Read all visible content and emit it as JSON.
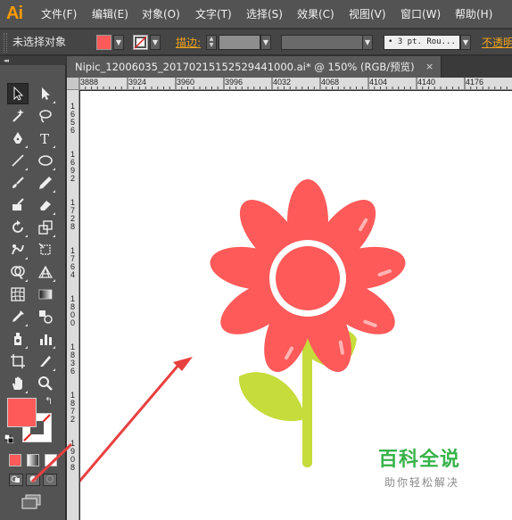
{
  "app": {
    "logo": "Ai"
  },
  "menu": {
    "items": [
      {
        "label": "文件(F)"
      },
      {
        "label": "编辑(E)"
      },
      {
        "label": "对象(O)"
      },
      {
        "label": "文字(T)"
      },
      {
        "label": "选择(S)"
      },
      {
        "label": "效果(C)"
      },
      {
        "label": "视图(V)"
      },
      {
        "label": "窗口(W)"
      },
      {
        "label": "帮助(H)"
      }
    ]
  },
  "controlbar": {
    "selection_status": "未选择对象",
    "fill_color": "#fe5a5a",
    "stroke_label": "描边:",
    "brush_definition": "• 3 pt. Rou...",
    "opacity_label": "不透明"
  },
  "tools": {
    "collapse": "◂◂",
    "fill_color": "#fe5a5a",
    "stroke_color": "#ffffff",
    "swap": "↰"
  },
  "document": {
    "tab_title": "Nipic_12006035_20170215152529441000.ai* @ 150% (RGB/预览)",
    "close": "×"
  },
  "ruler": {
    "horizontal": [
      "3888",
      "3924",
      "3960",
      "3996",
      "4032",
      "4068",
      "4104",
      "4140",
      "4176"
    ],
    "vertical": [
      "1656",
      "1692",
      "1728",
      "1764",
      "1800",
      "1836",
      "1872",
      "1908"
    ]
  },
  "artwork": {
    "petal_color": "#fe5a5a",
    "stem_color": "#c5dc3b",
    "leaf_color": "#c5dc3b",
    "arrow_color": "#e84040"
  },
  "watermark": {
    "title": "百科全说",
    "subtitle": "助你轻松解决"
  }
}
